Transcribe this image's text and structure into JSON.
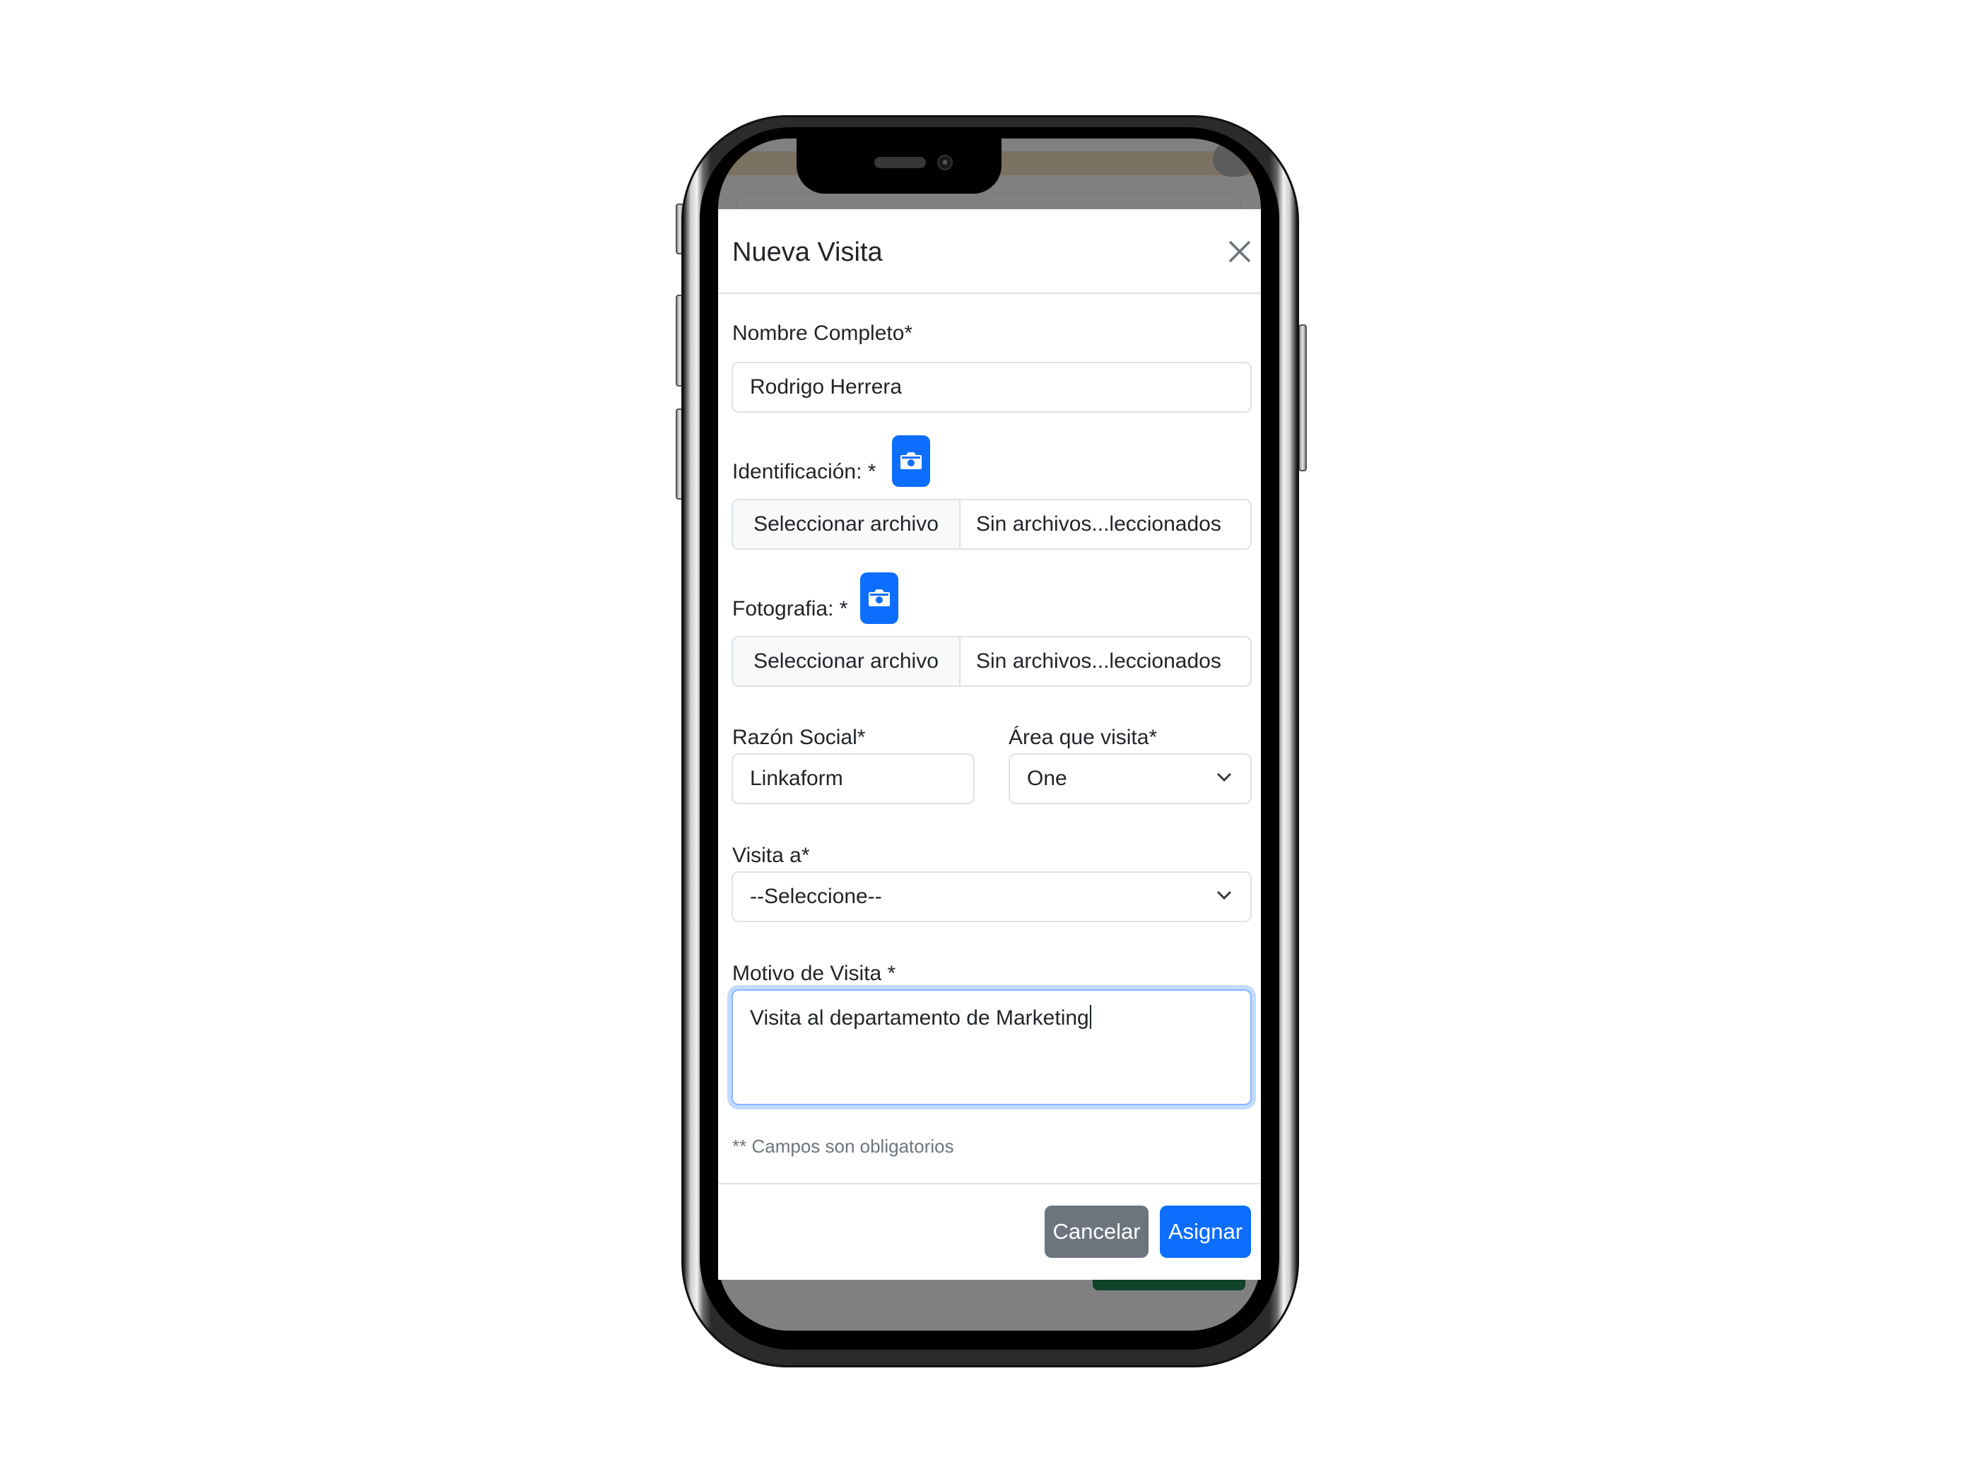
{
  "modal": {
    "title": "Nueva Visita",
    "close_icon": "close-icon"
  },
  "form": {
    "nombre": {
      "label": "Nombre Completo*",
      "value": "Rodrigo Herrera"
    },
    "identificacion": {
      "label": "Identificación: *",
      "camera_icon": "camera-icon",
      "file_button": "Seleccionar archivo",
      "file_status": "Sin archivos...leccionados"
    },
    "fotografia": {
      "label": "Fotografia: *",
      "camera_icon": "camera-icon",
      "file_button": "Seleccionar archivo",
      "file_status": "Sin archivos...leccionados"
    },
    "razon_social": {
      "label": "Razón Social*",
      "value": "Linkaform"
    },
    "area": {
      "label": "Área que visita*",
      "selected": "One",
      "icon": "chevron-down-icon"
    },
    "visita_a": {
      "label": "Visita a*",
      "selected": "--Seleccione--",
      "icon": "chevron-down-icon"
    },
    "motivo": {
      "label": "Motivo de Visita *",
      "value": "Visita al departamento de Marketing"
    },
    "hint": "** Campos son obligatorios"
  },
  "footer": {
    "cancel_label": "Cancelar",
    "submit_label": "Asignar"
  },
  "colors": {
    "primary": "#0d6efd",
    "secondary": "#6c757d",
    "backdrop": "#808080",
    "focus_border": "#86b7fe"
  }
}
